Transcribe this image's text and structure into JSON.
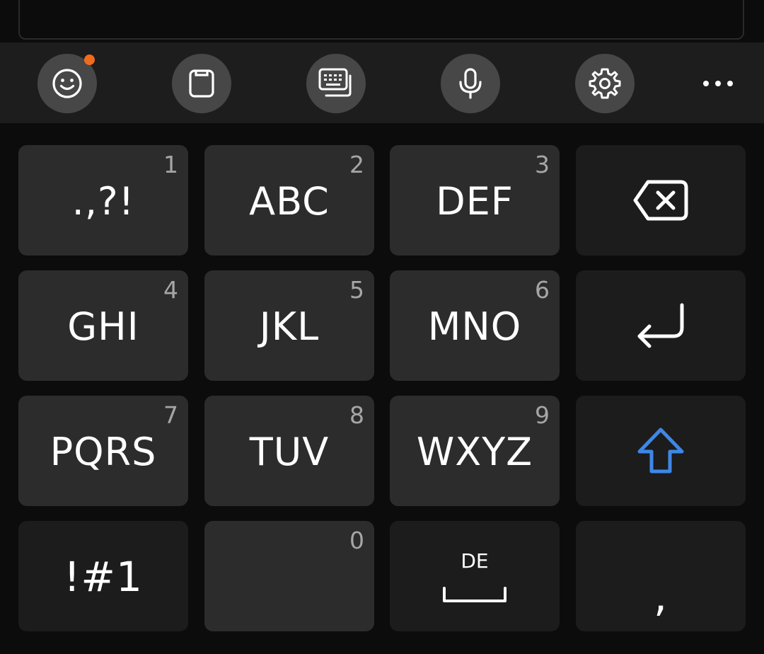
{
  "toolbar": {
    "items": [
      {
        "name": "emoji-icon",
        "notification_dot": true
      },
      {
        "name": "clipboard-icon"
      },
      {
        "name": "keyboard-mode-icon"
      },
      {
        "name": "microphone-icon"
      },
      {
        "name": "settings-gear-icon"
      },
      {
        "name": "more-horizontal-icon"
      }
    ]
  },
  "keyboard": {
    "rows": [
      [
        {
          "label": ".,?!",
          "number": "1"
        },
        {
          "label": "ABC",
          "number": "2"
        },
        {
          "label": "DEF",
          "number": "3"
        },
        {
          "icon": "backspace-icon"
        }
      ],
      [
        {
          "label": "GHI",
          "number": "4"
        },
        {
          "label": "JKL",
          "number": "5"
        },
        {
          "label": "MNO",
          "number": "6"
        },
        {
          "icon": "enter-icon"
        }
      ],
      [
        {
          "label": "PQRS",
          "number": "7"
        },
        {
          "label": "TUV",
          "number": "8"
        },
        {
          "label": "WXYZ",
          "number": "9"
        },
        {
          "icon": "shift-arrow-icon"
        }
      ],
      [
        {
          "label": "!#1"
        },
        {
          "label": "",
          "number": "0"
        },
        {
          "language": "DE",
          "icon": "space-bar-icon"
        },
        {
          "label": ","
        }
      ]
    ]
  },
  "colors": {
    "accent_shift": "#3e87e6",
    "notification_dot": "#f26b1a",
    "key_letter_bg": "#2c2c2c",
    "key_func_bg": "#1c1c1c",
    "toolbar_bg": "#1d1d1d",
    "tool_button_bg": "#474747"
  }
}
